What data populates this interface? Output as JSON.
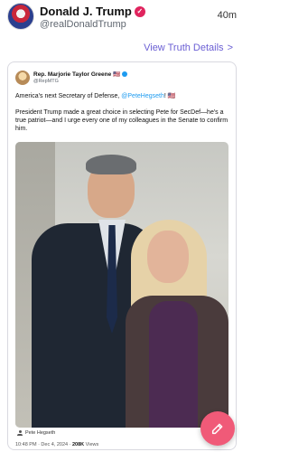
{
  "post": {
    "author_name": "Donald J. Trump",
    "author_handle": "@realDonaldTrump",
    "time_ago": "40m",
    "view_details_label": "View Truth Details",
    "view_details_chevron": ">"
  },
  "embedded": {
    "author_name": "Rep. Marjorie Taylor Greene",
    "author_flag": "🇺🇸",
    "author_handle": "@RepMTG",
    "line1_prefix": "America's next Secretary of Defense, ",
    "line1_mention": "@PeteHegseth",
    "line1_suffix": "! 🇺🇸",
    "body": "President Trump made a great choice in selecting Pete for SecDef—he's a true patriot—and I urge every one of my colleagues in the Senate to confirm him.",
    "photo_credit": "Pete Hegseth",
    "timestamp": "10:48 PM · Dec 4, 2024 · ",
    "views_count": "208K",
    "views_label": " Views"
  },
  "colors": {
    "accent": "#6b5fd4",
    "verified_badge": "#e0245e",
    "mention": "#1d9bf0",
    "fab": "#f05a78"
  },
  "icons": {
    "verified": "verified-badge-icon",
    "chevron": "chevron-right-icon",
    "compose": "compose-icon",
    "user": "user-icon"
  }
}
